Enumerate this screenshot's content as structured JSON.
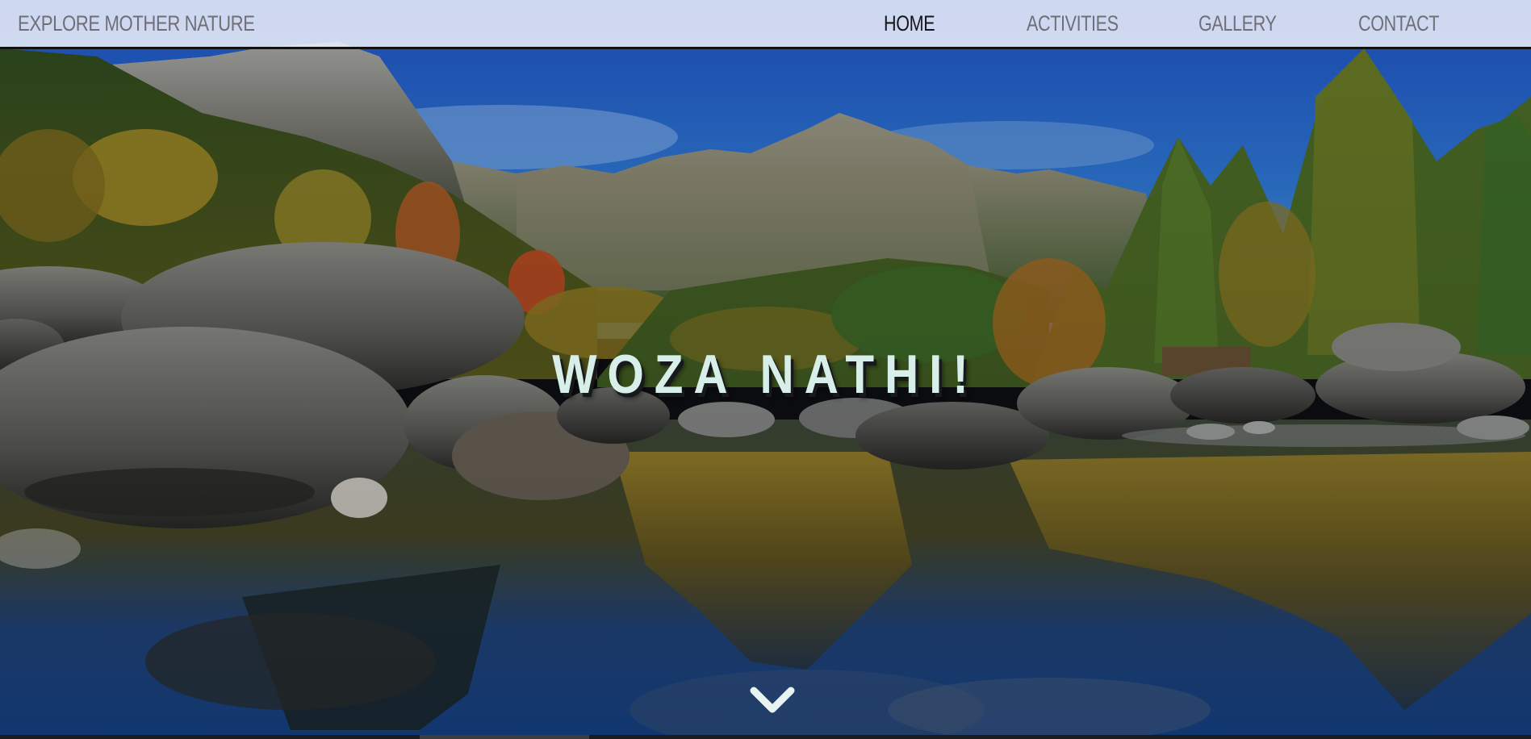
{
  "navbar": {
    "brand": "EXPLORE MOTHER NATURE",
    "links": [
      {
        "label": "HOME",
        "active": true
      },
      {
        "label": "ACTIVITIES",
        "active": false
      },
      {
        "label": "GALLERY",
        "active": false
      },
      {
        "label": "CONTACT",
        "active": false
      }
    ]
  },
  "hero": {
    "title": "WOZA NATHI!",
    "scroll_icon": "chevron-down-icon"
  },
  "colors": {
    "navbar_bg": "#eceffa",
    "nav_text": "#6d7077",
    "nav_active": "#15171b",
    "title_text": "#d8efe9",
    "title_shadow": "#17191c"
  }
}
